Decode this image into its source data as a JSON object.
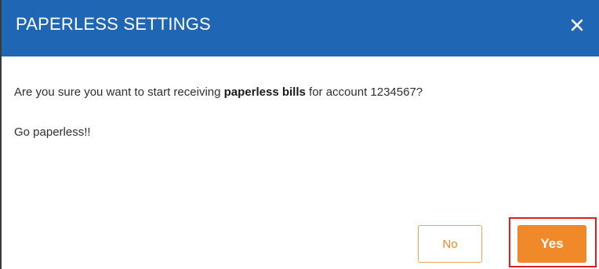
{
  "dialog": {
    "title": "PAPERLESS SETTINGS",
    "close_icon": "close-icon",
    "message": {
      "prefix": "Are you sure you want to start receiving ",
      "emphasis": "paperless bills",
      "suffix": " for account 1234567?"
    },
    "submessage": "Go paperless!!",
    "buttons": {
      "no_label": "No",
      "yes_label": "Yes"
    }
  },
  "colors": {
    "header": "#1f67b4",
    "accent_orange": "#f0892a",
    "highlight_red": "#e11d1d"
  }
}
